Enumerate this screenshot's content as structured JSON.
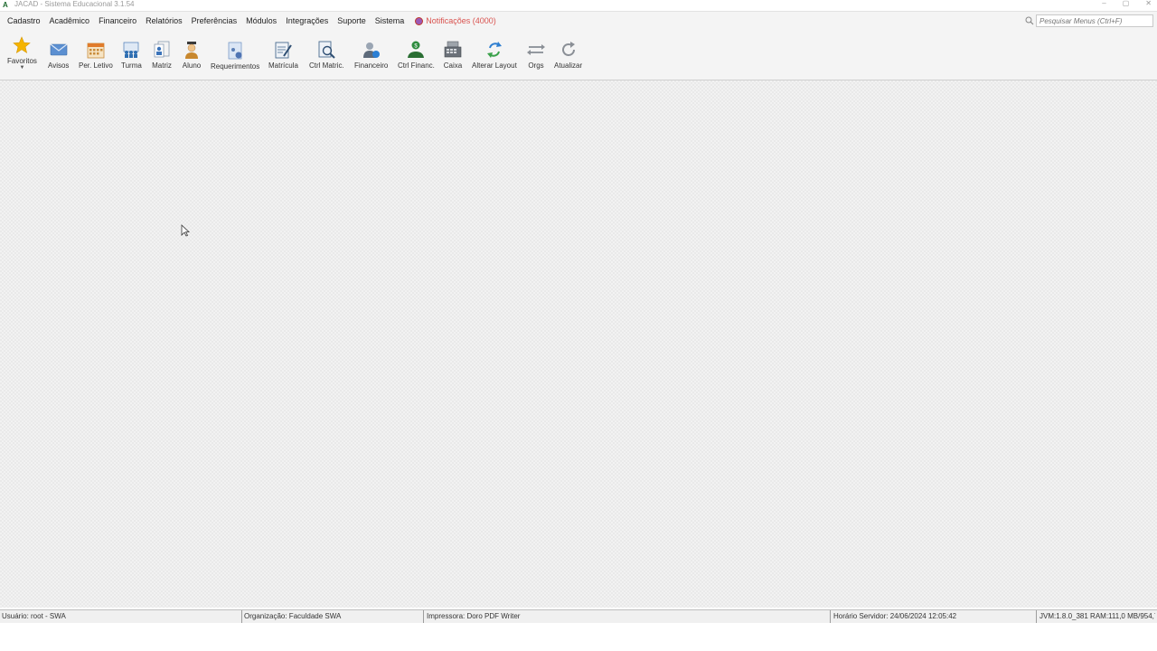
{
  "window": {
    "app_icon": "A",
    "title": "JACAD - Sistema Educacional 3.1.54"
  },
  "menu": {
    "items": [
      {
        "label": "Cadastro"
      },
      {
        "label": "Acadêmico"
      },
      {
        "label": "Financeiro"
      },
      {
        "label": "Relatórios"
      },
      {
        "label": "Preferências"
      },
      {
        "label": "Módulos"
      },
      {
        "label": "Integrações"
      },
      {
        "label": "Suporte"
      },
      {
        "label": "Sistema"
      }
    ],
    "notifications_label": "Notificações (4000)",
    "search_placeholder": "Pesquisar Menus (Ctrl+F)"
  },
  "toolbar": {
    "buttons": [
      {
        "label": "Favoritos",
        "icon": "star-icon"
      },
      {
        "label": "Avisos",
        "icon": "envelope-icon"
      },
      {
        "label": "Per. Letivo",
        "icon": "calendar-icon"
      },
      {
        "label": "Turma",
        "icon": "class-group-icon"
      },
      {
        "label": "Matriz",
        "icon": "matrix-icon"
      },
      {
        "label": "Aluno",
        "icon": "student-icon"
      },
      {
        "label": "Requerimentos",
        "icon": "request-icon"
      },
      {
        "label": "Matrícula",
        "icon": "enrollment-icon"
      },
      {
        "label": "Ctrl Matric.",
        "icon": "enrollment-control-icon"
      },
      {
        "label": "Financeiro",
        "icon": "finance-user-icon"
      },
      {
        "label": "Ctrl Financ.",
        "icon": "finance-control-icon"
      },
      {
        "label": "Caixa",
        "icon": "cash-register-icon"
      },
      {
        "label": "Alterar Layout",
        "icon": "swap-layout-icon"
      },
      {
        "label": "Orgs",
        "icon": "orgs-arrows-icon"
      },
      {
        "label": "Atualizar",
        "icon": "refresh-icon"
      }
    ]
  },
  "status": {
    "user": "Usuário: root - SWA",
    "organization": "Organização: Faculdade SWA",
    "printer": "Impressora: Doro PDF Writer",
    "server_time": "Horário Servidor: 24/06/2024 12:05:42",
    "jvm": "JVM:1.8.0_381  RAM:111,0 MB/954,7 MB"
  },
  "colors": {
    "toolbar_bg": "#f4f4f4",
    "workspace_bg": "#f2f2f2",
    "notification": "#d9534f"
  }
}
